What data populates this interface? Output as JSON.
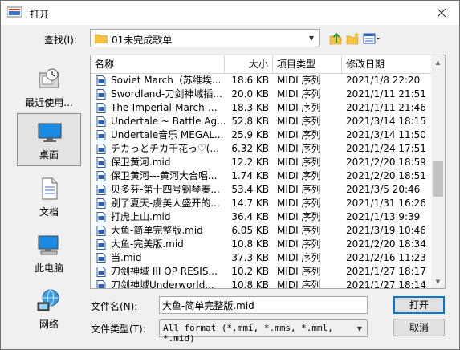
{
  "window": {
    "title": "打开"
  },
  "lookin": {
    "label": "查找(I):",
    "value": "01未完成歌单"
  },
  "places": [
    {
      "label": "最近使用...",
      "icon": "recent-items-icon"
    },
    {
      "label": "桌面",
      "icon": "desktop-icon"
    },
    {
      "label": "文档",
      "icon": "documents-icon"
    },
    {
      "label": "此电脑",
      "icon": "computer-icon"
    },
    {
      "label": "网络",
      "icon": "network-icon"
    }
  ],
  "table": {
    "headers": [
      "名称",
      "大小",
      "项目类型",
      "修改日期"
    ],
    "rows": [
      {
        "name": "Soviet March（苏维埃...",
        "size": "18.6 KB",
        "type": "MIDI 序列",
        "date": "2021/1/8 22:20"
      },
      {
        "name": "Swordland-刀剑神域插...",
        "size": "20.0 KB",
        "type": "MIDI 序列",
        "date": "2021/1/11 21:51"
      },
      {
        "name": "The-Imperial-March-...",
        "size": "18.3 KB",
        "type": "MIDI 序列",
        "date": "2021/1/11 21:46"
      },
      {
        "name": "Undertale ~ Battle Ag...",
        "size": "52.8 KB",
        "type": "MIDI 序列",
        "date": "2021/3/14 18:15"
      },
      {
        "name": "Undertale音乐 MEGAL...",
        "size": "25.9 KB",
        "type": "MIDI 序列",
        "date": "2021/3/14 11:50"
      },
      {
        "name": "チカっとチカ千花っ♡(...",
        "size": "6.32 KB",
        "type": "MIDI 序列",
        "date": "2021/1/24 17:51"
      },
      {
        "name": "保卫黄河.mid",
        "size": "12.2 KB",
        "type": "MIDI 序列",
        "date": "2021/2/20 18:59"
      },
      {
        "name": "保卫黄河---黄河大合唱...",
        "size": "1.74 KB",
        "type": "MIDI 序列",
        "date": "2021/2/20 18:51"
      },
      {
        "name": "贝多芬-第十四号钢琴奏...",
        "size": "53.4 KB",
        "type": "MIDI 序列",
        "date": "2021/3/5 20:46"
      },
      {
        "name": "别了夏天-虞美人盛开的...",
        "size": "14.7 KB",
        "type": "MIDI 序列",
        "date": "2021/1/31 16:26"
      },
      {
        "name": "打虎上山.mid",
        "size": "36.4 KB",
        "type": "MIDI 序列",
        "date": "2021/1/13 9:39"
      },
      {
        "name": "大鱼-简单完整版.mid",
        "size": "6.05 KB",
        "type": "MIDI 序列",
        "date": "2021/3/19 10:46"
      },
      {
        "name": "大鱼-完美版.mid",
        "size": "10.8 KB",
        "type": "MIDI 序列",
        "date": "2021/2/20 18:34"
      },
      {
        "name": "当.mid",
        "size": "37.3 KB",
        "type": "MIDI 序列",
        "date": "2021/2/16 11:23"
      },
      {
        "name": "刀剑神域 III OP RESIS...",
        "size": "10.2 KB",
        "type": "MIDI 序列",
        "date": "2021/1/27 18:17"
      },
      {
        "name": "刀剑神域Underworld...",
        "size": "10.8 KB",
        "type": "MIDI 序列",
        "date": "2021/1/27 18:14"
      }
    ]
  },
  "filename": {
    "label": "文件名(N):",
    "value": "大鱼-简单完整版.mid"
  },
  "filetype": {
    "label": "文件类型(T):",
    "value": "All format (*.mmi, *.mms, *.mml, *.mid)"
  },
  "buttons": {
    "open": "打开",
    "cancel": "取消"
  },
  "colors": {
    "accent": "#0078d7",
    "selected_place_bg": "#e3e3e3",
    "folder": "#f5c342",
    "midi_icon": "#2a5fb0"
  }
}
